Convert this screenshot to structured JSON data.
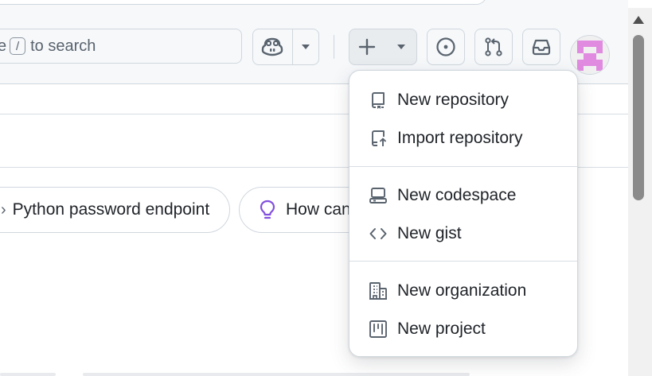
{
  "header": {
    "search": {
      "prefix": "e",
      "key_hint": "/",
      "suffix": "to search"
    },
    "buttons": {
      "copilot": "copilot-icon",
      "copilot_menu": "triangle-down-icon",
      "create": "plus-icon",
      "issues": "issue-opened-icon",
      "pull_requests": "git-pull-request-icon",
      "inbox": "inbox-icon"
    }
  },
  "suggestions": [
    {
      "label": "Python password endpoint",
      "icon": "arrow-icon"
    },
    {
      "label": "How can",
      "icon": "light-bulb-icon"
    }
  ],
  "create_menu": {
    "groups": [
      [
        {
          "label": "New repository",
          "icon": "repo-icon"
        },
        {
          "label": "Import repository",
          "icon": "repo-push-icon"
        }
      ],
      [
        {
          "label": "New codespace",
          "icon": "codespaces-icon"
        },
        {
          "label": "New gist",
          "icon": "code-icon"
        }
      ],
      [
        {
          "label": "New organization",
          "icon": "organization-icon"
        },
        {
          "label": "New project",
          "icon": "project-icon"
        }
      ]
    ]
  },
  "colors": {
    "header_bg": "#f6f8fa",
    "border": "#d0d7de",
    "text": "#1f2328",
    "muted": "#59636e",
    "avatar_pink": "#e08ae0",
    "bulb_purple": "#8250df"
  }
}
